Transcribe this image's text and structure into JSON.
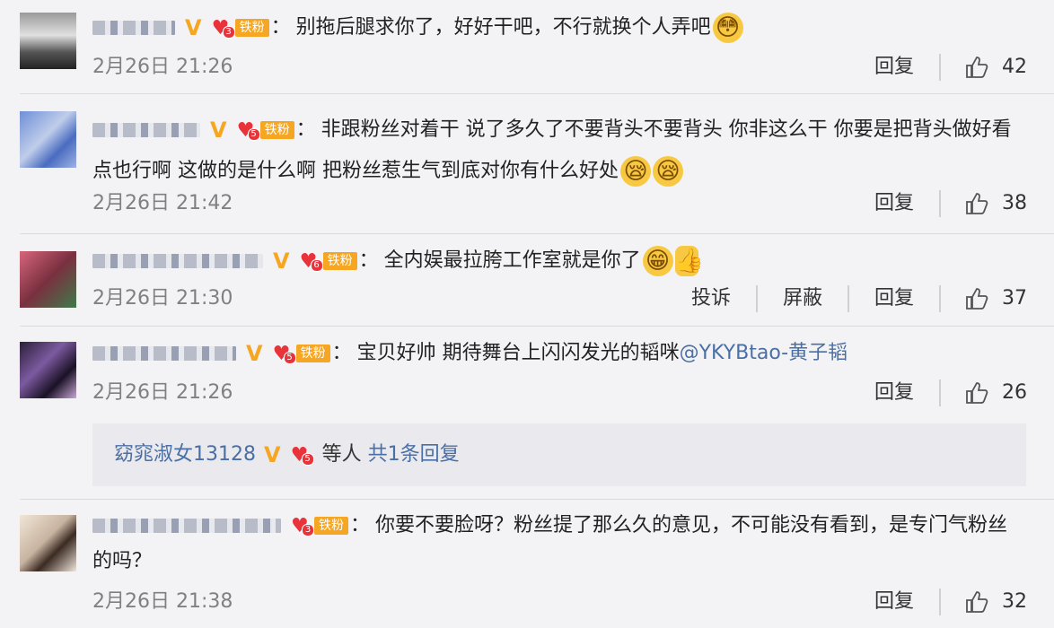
{
  "fan_label": "铁粉",
  "vip_glyph": "V",
  "colon": "：",
  "like_icon": "thumbs-up-icon",
  "comments": [
    {
      "text": "别拖后腿求你了，好好干吧，不行就换个人弄吧",
      "fan_level": "3",
      "time": "2月26日 21:26",
      "actions": [
        "回复"
      ],
      "likes": "42",
      "emoji": [
        "😳"
      ]
    },
    {
      "text": "非跟粉丝对着干  说了多久了不要背头不要背头  你非这么干  你要是把背头做好看点也行啊 这做的是什么啊 把粉丝惹生气到底对你有什么好处",
      "fan_level": "5",
      "time": "2月26日 21:42",
      "actions": [
        "回复"
      ],
      "likes": "38",
      "emoji": [
        "😪",
        "😪"
      ]
    },
    {
      "text": "全内娱最拉胯工作室就是你了",
      "fan_level": "6",
      "time": "2月26日 21:30",
      "actions": [
        "投诉",
        "屏蔽",
        "回复"
      ],
      "likes": "37",
      "emoji": [
        "😁",
        "👍"
      ]
    },
    {
      "text": "宝贝好帅 期待舞台上闪闪发光的韬咪",
      "mention": "@YKYBtao-黄子韬",
      "fan_level": "5",
      "time": "2月26日 21:26",
      "actions": [
        "回复"
      ],
      "likes": "26",
      "reply_box": {
        "name": "窈窕淑女13128",
        "fan_level": "5",
        "suffix": "等人",
        "more": "共1条回复"
      }
    },
    {
      "text": "你要不要脸呀？粉丝提了那么久的意见，不可能没有看到，是专门气粉丝的吗？",
      "fan_level": "3",
      "time": "2月26日 21:38",
      "actions": [
        "回复"
      ],
      "likes": "32"
    }
  ]
}
